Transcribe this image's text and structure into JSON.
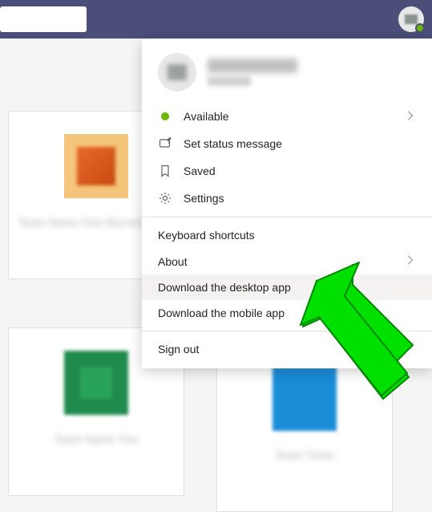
{
  "topbar": {
    "search_placeholder": ""
  },
  "profile": {
    "name": "User Name",
    "email": "user@example.com"
  },
  "menu": {
    "available_label": "Available",
    "set_status_label": "Set status message",
    "saved_label": "Saved",
    "settings_label": "Settings",
    "keyboard_label": "Keyboard shortcuts",
    "about_label": "About",
    "download_desktop_label": "Download the desktop app",
    "download_mobile_label": "Download the mobile app",
    "signout_label": "Sign out"
  },
  "cards": {
    "card1_title": "Team Name One Blurred String",
    "card2_title": "Team Name Two",
    "card3_title": "Team Three"
  },
  "colors": {
    "brand": "#4a4e78",
    "available": "#6bb700",
    "arrow": "#00e000"
  }
}
